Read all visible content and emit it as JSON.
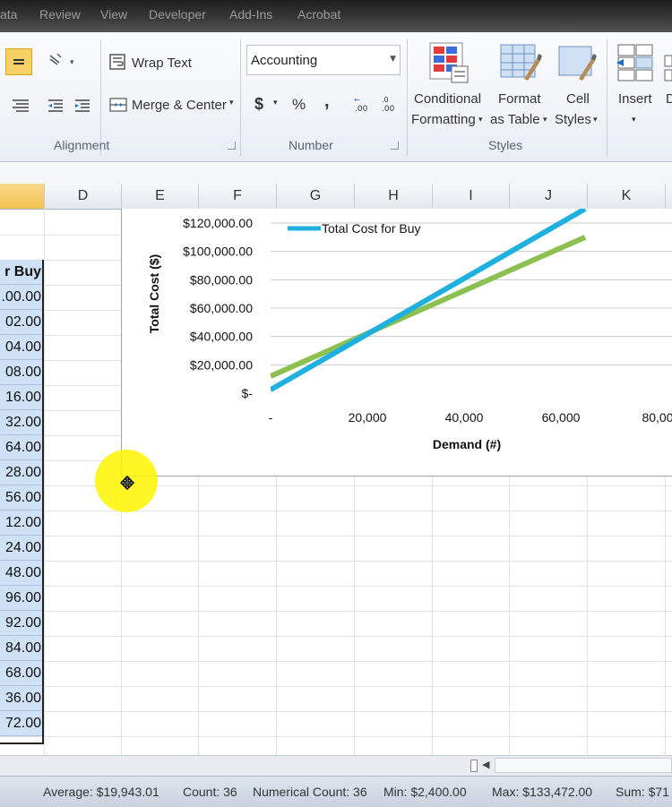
{
  "menu": {
    "tabs": [
      "ata",
      "Review",
      "View",
      "Developer",
      "Add-Ins",
      "Acrobat"
    ]
  },
  "ribbon": {
    "alignment": {
      "wrap_text": "Wrap Text",
      "merge_center": "Merge & Center",
      "group_label": "Alignment"
    },
    "number": {
      "format_value": "Accounting",
      "currency": "$",
      "percent": "%",
      "comma": ",",
      "group_label": "Number"
    },
    "styles": {
      "conditional_line1": "Conditional",
      "conditional_line2": "Formatting",
      "format_line1": "Format",
      "format_line2": "as Table",
      "cell_line1": "Cell",
      "cell_line2": "Styles",
      "group_label": "Styles"
    },
    "cells": {
      "insert": "Insert",
      "delete_partial": "D"
    }
  },
  "columns": [
    "D",
    "E",
    "F",
    "G",
    "H",
    "I",
    "J",
    "K"
  ],
  "column_c": {
    "header": "r Buy",
    "values": [
      ".00.00",
      "02.00",
      "04.00",
      "08.00",
      "16.00",
      "32.00",
      "64.00",
      "28.00",
      "56.00",
      "12.00",
      "24.00",
      "48.00",
      "96.00",
      "92.00",
      "84.00",
      "68.00",
      "36.00",
      "72.00"
    ]
  },
  "chart_data": {
    "type": "line",
    "series": [
      {
        "name": "Total Cost for Buy",
        "color": "#1fb0e0",
        "x": [
          0,
          65000
        ],
        "y": [
          2400,
          130000
        ]
      },
      {
        "name": "",
        "color": "#8cc152",
        "x": [
          0,
          65000
        ],
        "y": [
          12000,
          110000
        ]
      }
    ],
    "xlabel": "Demand (#)",
    "ylabel": "Total Cost ($)",
    "xlim": [
      0,
      80000
    ],
    "ylim": [
      0,
      120000
    ],
    "x_ticks": [
      "-",
      "20,000",
      "40,000",
      "60,000",
      "80,00"
    ],
    "y_ticks": [
      "$-",
      "$20,000.00",
      "$40,000.00",
      "$60,000.00",
      "$80,000.00",
      "$100,000.00",
      "$120,000.00"
    ],
    "legend": "top-left",
    "grid": true
  },
  "status": {
    "average": "Average: $19,943.01",
    "count": "Count: 36",
    "numerical_count": "Numerical Count: 36",
    "min": "Min: $2,400.00",
    "max": "Max: $133,472.00",
    "sum": "Sum: $71"
  }
}
